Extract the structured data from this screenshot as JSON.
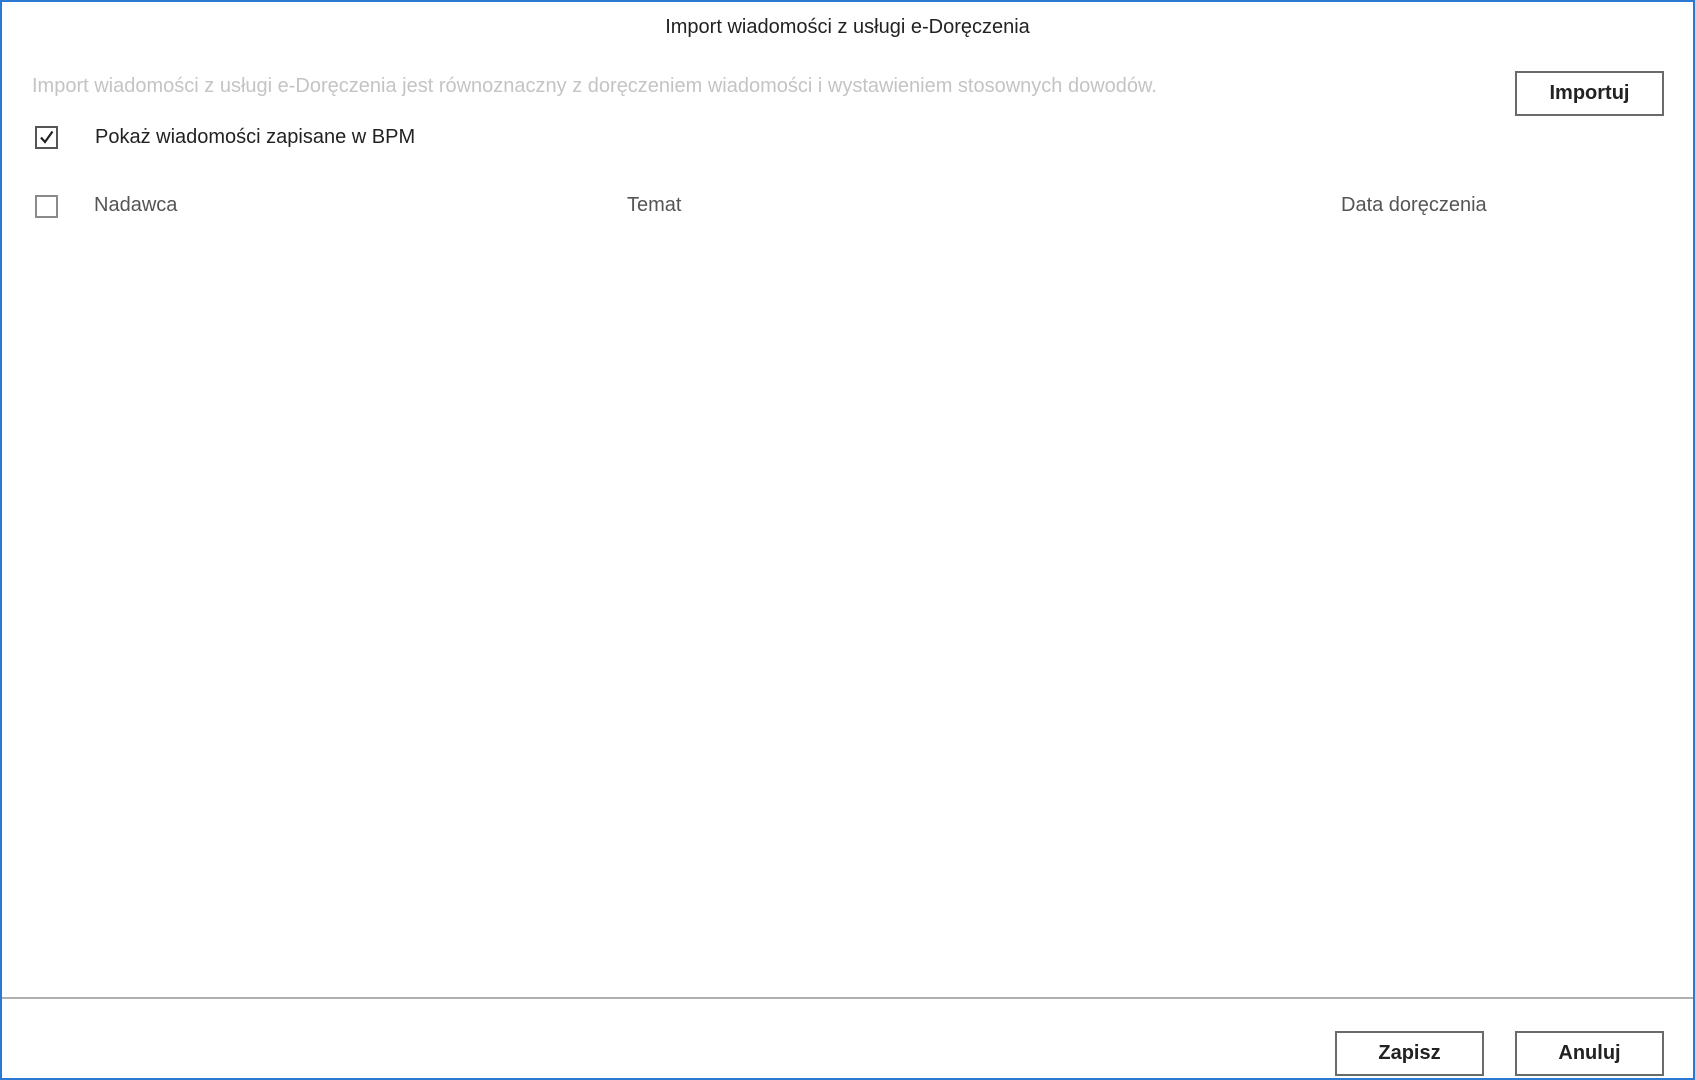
{
  "dialog": {
    "title": "Import wiadomości z usługi e-Doręczenia",
    "info_text": "Import wiadomości z usługi e-Doręczenia jest równoznaczny z doręczeniem wiadomości i wystawieniem stosownych dowodów.",
    "import_button": "Importuj"
  },
  "filter": {
    "show_saved_label": "Pokaż wiadomości zapisane w BPM",
    "show_saved_checked": true
  },
  "table": {
    "select_all_checked": false,
    "columns": [
      "Nadawca",
      "Temat",
      "Data doręczenia"
    ],
    "rows": []
  },
  "footer": {
    "save_button": "Zapisz",
    "cancel_button": "Anuluj"
  },
  "colors": {
    "window_border": "#2b79d0",
    "info_text": "#c4c4c4",
    "button_border": "#6a6a6a"
  }
}
